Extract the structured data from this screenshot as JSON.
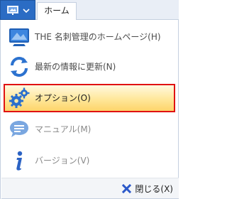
{
  "tabbar": {
    "app_button_icon": "slideshow-icon",
    "dropdown_icon": "chevron-down-icon",
    "home_tab_label": "ホーム"
  },
  "menu": {
    "items": [
      {
        "label": "THE 名刺管理のホームページ(H)",
        "icon": "monitor-icon",
        "state": "normal"
      },
      {
        "label": "最新の情報に更新(N)",
        "icon": "refresh-icon",
        "state": "normal"
      },
      {
        "label": "オプション(O)",
        "icon": "gears-icon",
        "state": "selected"
      },
      {
        "label": "マニュアル(M)",
        "icon": "chat-bubble-icon",
        "state": "disabled"
      },
      {
        "label": "バージョン(V)",
        "icon": "info-icon",
        "state": "disabled"
      }
    ],
    "close_label": "閉じる(X)",
    "close_icon": "close-x-icon"
  },
  "colors": {
    "accent_blue": "#2b6cc4",
    "selection_border": "#e01212",
    "selection_fill": "#ffe79a",
    "close_x": "#2c59c9"
  }
}
